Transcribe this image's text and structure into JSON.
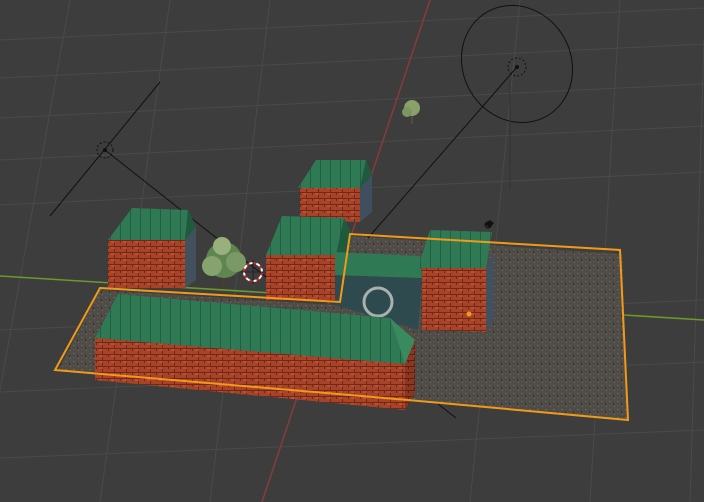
{
  "viewport": {
    "background": "#3d3d3d",
    "grid_color": "#4a4a4a",
    "x_axis_color": "#8a3a3a",
    "y_axis_color": "#6a9a2a",
    "selection_outline_color": "#f29a18"
  },
  "scene_objects": [
    {
      "name": "building-complex",
      "selected": true
    },
    {
      "name": "light-left",
      "type": "light"
    },
    {
      "name": "light-right",
      "type": "light"
    },
    {
      "name": "camera-small",
      "type": "camera"
    },
    {
      "name": "tree-main",
      "type": "tree"
    },
    {
      "name": "tree-distant",
      "type": "tree"
    },
    {
      "name": "3d-cursor"
    }
  ]
}
